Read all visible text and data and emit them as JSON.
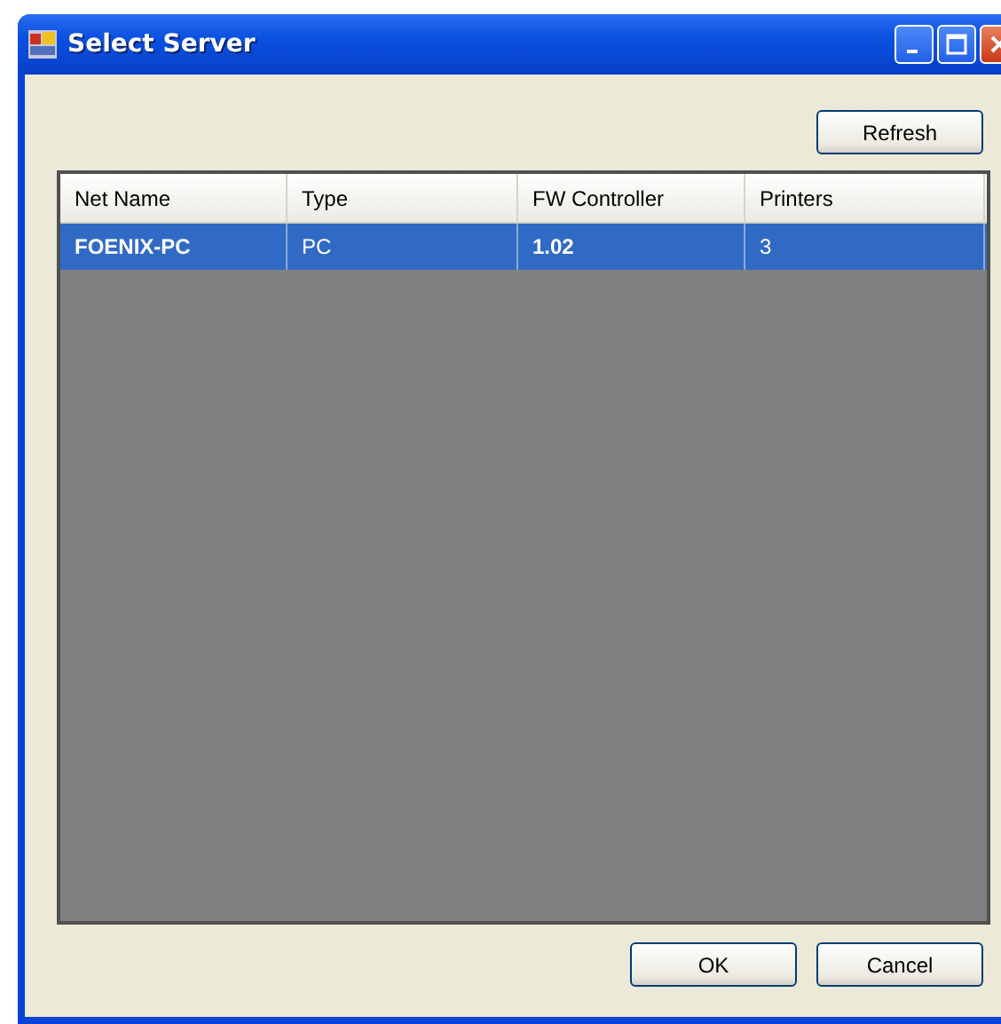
{
  "window": {
    "title": "Select Server"
  },
  "refresh_button": "Refresh",
  "table": {
    "columns": [
      "Net Name",
      "Type",
      "FW Controller",
      "Printers"
    ],
    "rows": [
      {
        "cells": [
          "FOENIX-PC",
          "PC",
          "1.02",
          "3"
        ],
        "selected": true
      }
    ]
  },
  "buttons": [
    "OK",
    "Cancel"
  ]
}
